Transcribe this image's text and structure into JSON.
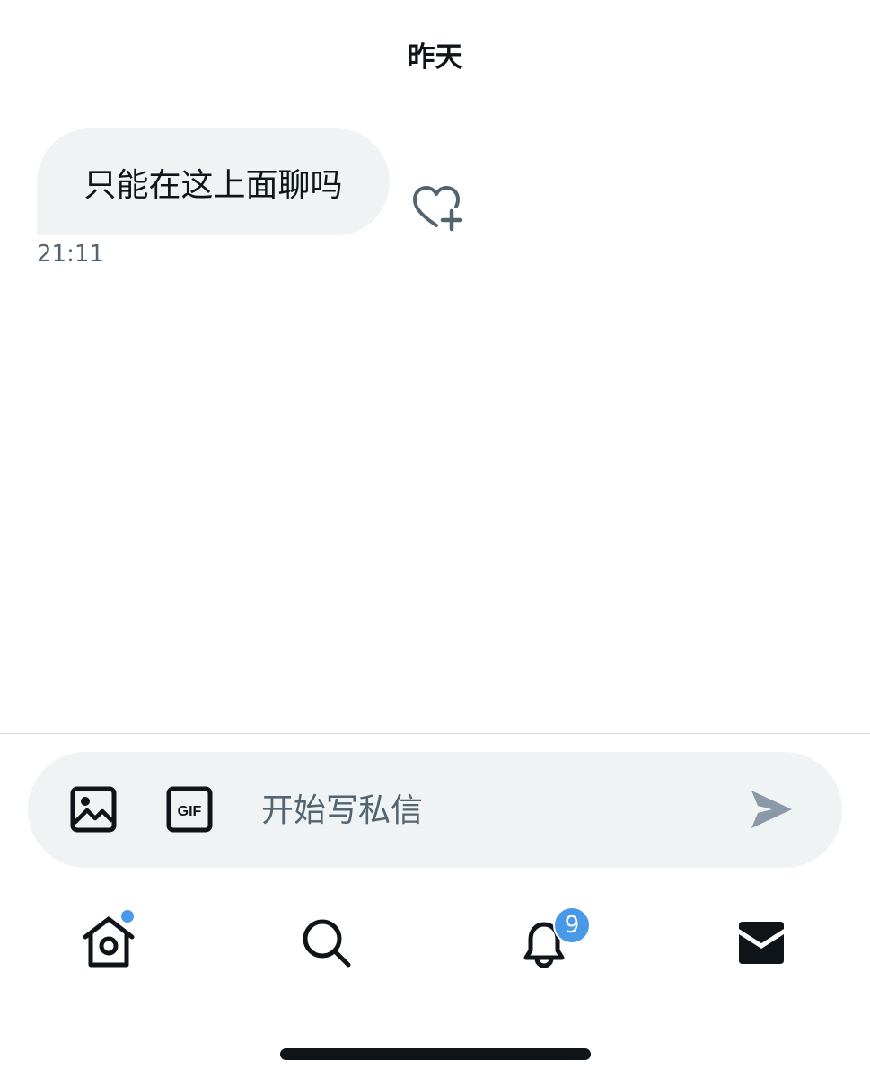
{
  "conversation": {
    "date_header": "昨天",
    "messages": [
      {
        "text": "只能在这上面聊吗",
        "time": "21:11"
      }
    ]
  },
  "composer": {
    "placeholder": "开始写私信",
    "value": "",
    "image_icon": "image-icon",
    "gif_icon": "gif-icon",
    "send_icon": "send-icon",
    "gif_label": "GIF"
  },
  "tabbar": {
    "items": [
      {
        "icon": "home-icon",
        "has_dot": true
      },
      {
        "icon": "search-icon"
      },
      {
        "icon": "bell-icon",
        "badge": "9"
      },
      {
        "icon": "mail-icon",
        "active": true
      }
    ]
  },
  "colors": {
    "accent": "#4a99e9",
    "bubble_bg": "#eff3f4",
    "text_primary": "#0f1419",
    "text_secondary": "#536471"
  }
}
